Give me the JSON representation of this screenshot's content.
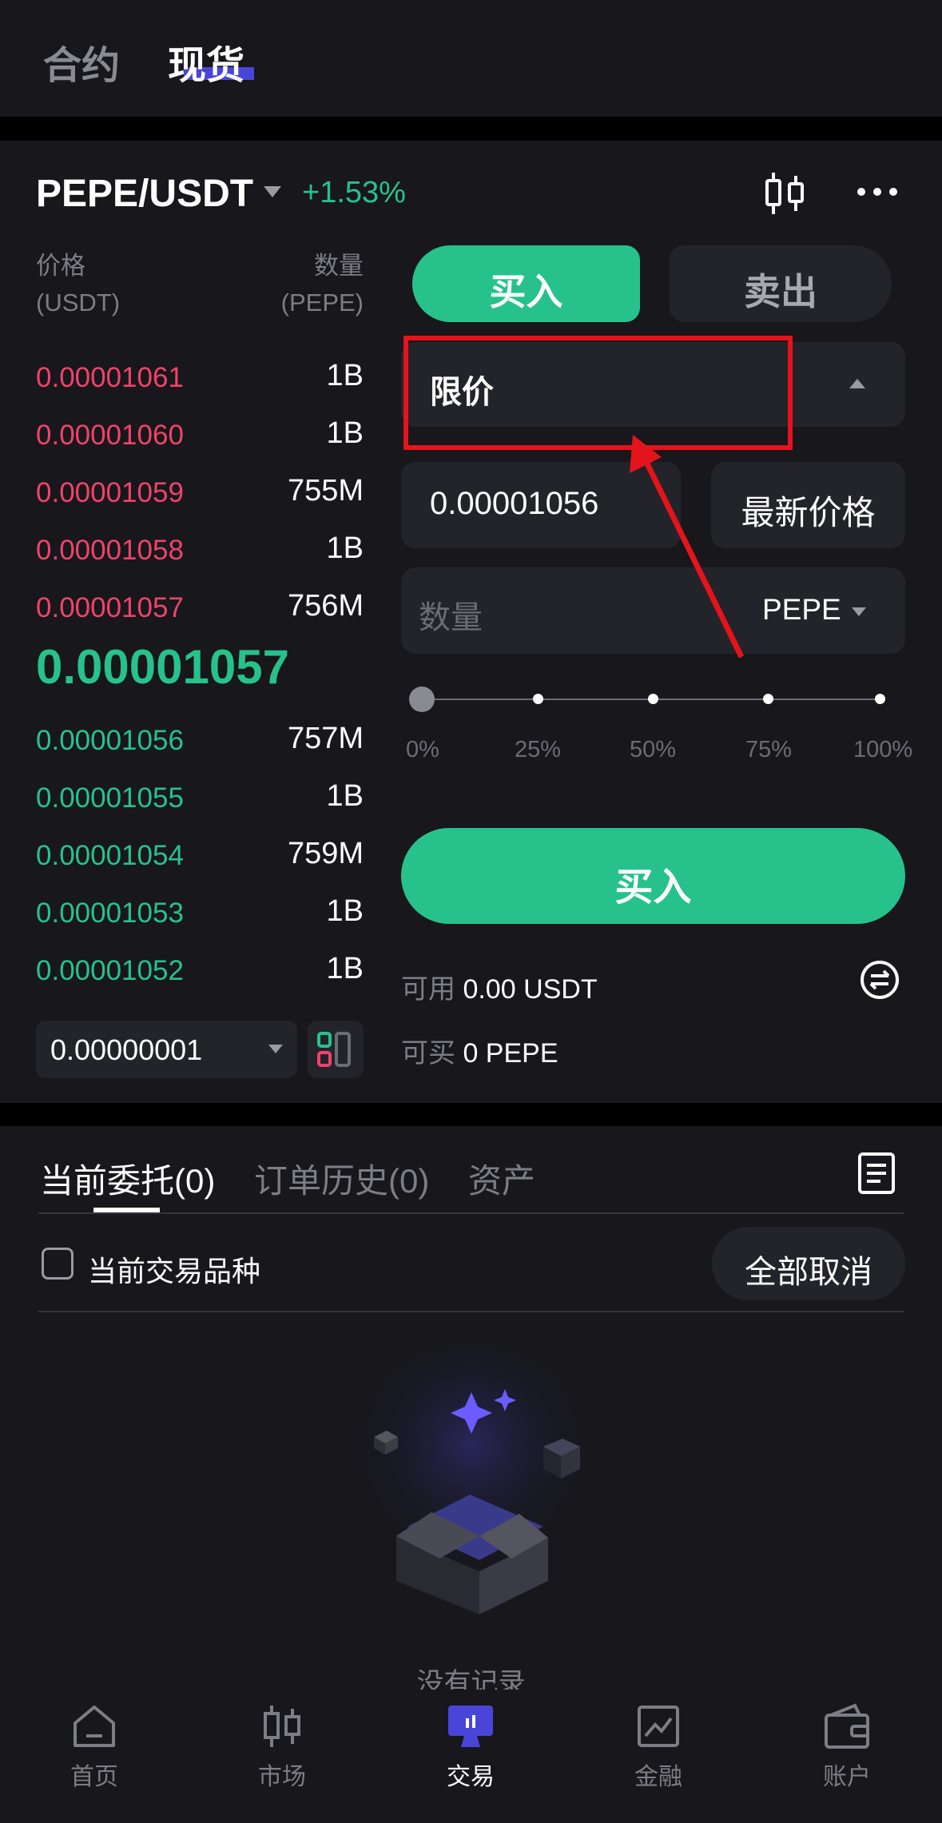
{
  "mode_tabs": {
    "futures": "合约",
    "spot": "现货"
  },
  "pair": {
    "name": "PEPE/USDT",
    "change": "+1.53%"
  },
  "orderbook": {
    "price_header": "价格",
    "price_unit": "(USDT)",
    "qty_header": "数量",
    "qty_unit": "(PEPE)",
    "asks": [
      {
        "price": "0.00001061",
        "qty": "1B"
      },
      {
        "price": "0.00001060",
        "qty": "1B"
      },
      {
        "price": "0.00001059",
        "qty": "755M"
      },
      {
        "price": "0.00001058",
        "qty": "1B"
      },
      {
        "price": "0.00001057",
        "qty": "756M"
      }
    ],
    "last_price": "0.00001057",
    "bids": [
      {
        "price": "0.00001056",
        "qty": "757M"
      },
      {
        "price": "0.00001055",
        "qty": "1B"
      },
      {
        "price": "0.00001054",
        "qty": "759M"
      },
      {
        "price": "0.00001053",
        "qty": "1B"
      },
      {
        "price": "0.00001052",
        "qty": "1B"
      }
    ],
    "precision": "0.00000001"
  },
  "order_form": {
    "buy_label": "买入",
    "sell_label": "卖出",
    "order_type": "限价",
    "price_value": "0.00001056",
    "latest_price_label": "最新价格",
    "qty_placeholder": "数量",
    "qty_unit": "PEPE",
    "slider_labels": [
      "0%",
      "25%",
      "50%",
      "75%",
      "100%"
    ],
    "slider_level": 0,
    "submit_label": "买入",
    "available_label": "可用",
    "available_value": "0.00 USDT",
    "can_buy_label": "可买",
    "can_buy_value": "0 PEPE"
  },
  "orders": {
    "tabs": [
      "当前委托(0)",
      "订单历史(0)",
      "资产"
    ],
    "current_pair_only": "当前交易品种",
    "cancel_all": "全部取消",
    "empty_text": "没有记录"
  },
  "bottom_nav": [
    {
      "label": "首页",
      "icon": "home-icon"
    },
    {
      "label": "市场",
      "icon": "candlestick-icon"
    },
    {
      "label": "交易",
      "icon": "trade-icon"
    },
    {
      "label": "金融",
      "icon": "chart-icon"
    },
    {
      "label": "账户",
      "icon": "wallet-icon"
    }
  ],
  "colors": {
    "buy": "#27c28b",
    "sell": "#f0436a",
    "accent": "#4a45d9",
    "annotation": "#e5131b"
  }
}
